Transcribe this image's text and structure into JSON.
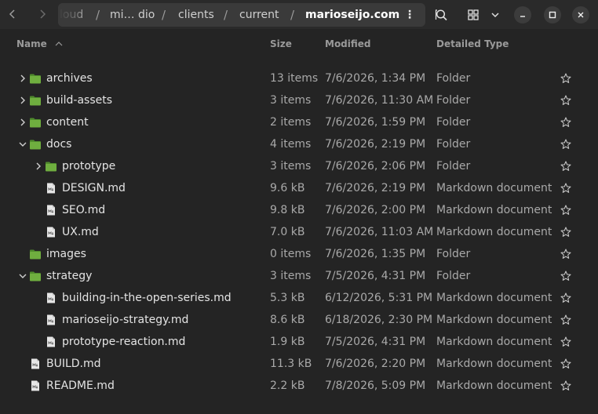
{
  "header": {
    "breadcrumbs": [
      {
        "label": "loud"
      },
      {
        "label": "mi… dio"
      },
      {
        "label": "clients"
      },
      {
        "label": "current"
      },
      {
        "label": "marioseijo.com",
        "current": true
      }
    ],
    "separator": "/",
    "menu_glyph": "⋮"
  },
  "columns": {
    "name": "Name",
    "size": "Size",
    "modified": "Modified",
    "type": "Detailed Type"
  },
  "rows": [
    {
      "name": "archives",
      "size": "13 items",
      "modified": "7/6/2026, 1:34 PM",
      "type": "Folder",
      "kind": "folder",
      "depth": 0,
      "expander": "collapsed"
    },
    {
      "name": "build-assets",
      "size": "3 items",
      "modified": "7/6/2026, 11:30 AM",
      "type": "Folder",
      "kind": "folder",
      "depth": 0,
      "expander": "collapsed"
    },
    {
      "name": "content",
      "size": "2 items",
      "modified": "7/6/2026, 1:59 PM",
      "type": "Folder",
      "kind": "folder",
      "depth": 0,
      "expander": "collapsed"
    },
    {
      "name": "docs",
      "size": "4 items",
      "modified": "7/6/2026, 2:19 PM",
      "type": "Folder",
      "kind": "folder",
      "depth": 0,
      "expander": "expanded"
    },
    {
      "name": "prototype",
      "size": "3 items",
      "modified": "7/6/2026, 2:06 PM",
      "type": "Folder",
      "kind": "folder",
      "depth": 1,
      "expander": "collapsed"
    },
    {
      "name": "DESIGN.md",
      "size": "9.6 kB",
      "modified": "7/6/2026, 2:19 PM",
      "type": "Markdown document",
      "kind": "file",
      "depth": 1,
      "expander": "none"
    },
    {
      "name": "SEO.md",
      "size": "9.8 kB",
      "modified": "7/6/2026, 2:00 PM",
      "type": "Markdown document",
      "kind": "file",
      "depth": 1,
      "expander": "none"
    },
    {
      "name": "UX.md",
      "size": "7.0 kB",
      "modified": "7/6/2026, 11:03 AM",
      "type": "Markdown document",
      "kind": "file",
      "depth": 1,
      "expander": "none"
    },
    {
      "name": "images",
      "size": "0 items",
      "modified": "7/6/2026, 1:35 PM",
      "type": "Folder",
      "kind": "folder",
      "depth": 0,
      "expander": "none"
    },
    {
      "name": "strategy",
      "size": "3 items",
      "modified": "7/5/2026, 4:31 PM",
      "type": "Folder",
      "kind": "folder",
      "depth": 0,
      "expander": "expanded"
    },
    {
      "name": "building-in-the-open-series.md",
      "size": "5.3 kB",
      "modified": "6/12/2026, 5:31 PM",
      "type": "Markdown document",
      "kind": "file",
      "depth": 1,
      "expander": "none"
    },
    {
      "name": "marioseijo-strategy.md",
      "size": "8.6 kB",
      "modified": "6/18/2026, 2:30 PM",
      "type": "Markdown document",
      "kind": "file",
      "depth": 1,
      "expander": "none"
    },
    {
      "name": "prototype-reaction.md",
      "size": "1.9 kB",
      "modified": "7/5/2026, 4:31 PM",
      "type": "Markdown document",
      "kind": "file",
      "depth": 1,
      "expander": "none"
    },
    {
      "name": "BUILD.md",
      "size": "11.3 kB",
      "modified": "7/6/2026, 2:20 PM",
      "type": "Markdown document",
      "kind": "file",
      "depth": 0,
      "expander": "none"
    },
    {
      "name": "README.md",
      "size": "2.2 kB",
      "modified": "7/8/2026, 5:09 PM",
      "type": "Markdown document",
      "kind": "file",
      "depth": 0,
      "expander": "none"
    }
  ],
  "icons": {
    "back": "chevron-left-icon",
    "forward": "chevron-right-icon",
    "menu": "vertical-ellipsis-icon",
    "search": "search-icon",
    "view": "grid-view-icon",
    "view_options": "chevron-down-icon",
    "minimize": "minimize-icon",
    "maximize": "maximize-icon",
    "close": "close-icon",
    "folder": "folder-icon",
    "file": "markdown-file-icon",
    "star": "star-icon"
  },
  "colors": {
    "background": "#242424",
    "folder": "#6fae3f",
    "file": "#e6e6e6"
  }
}
